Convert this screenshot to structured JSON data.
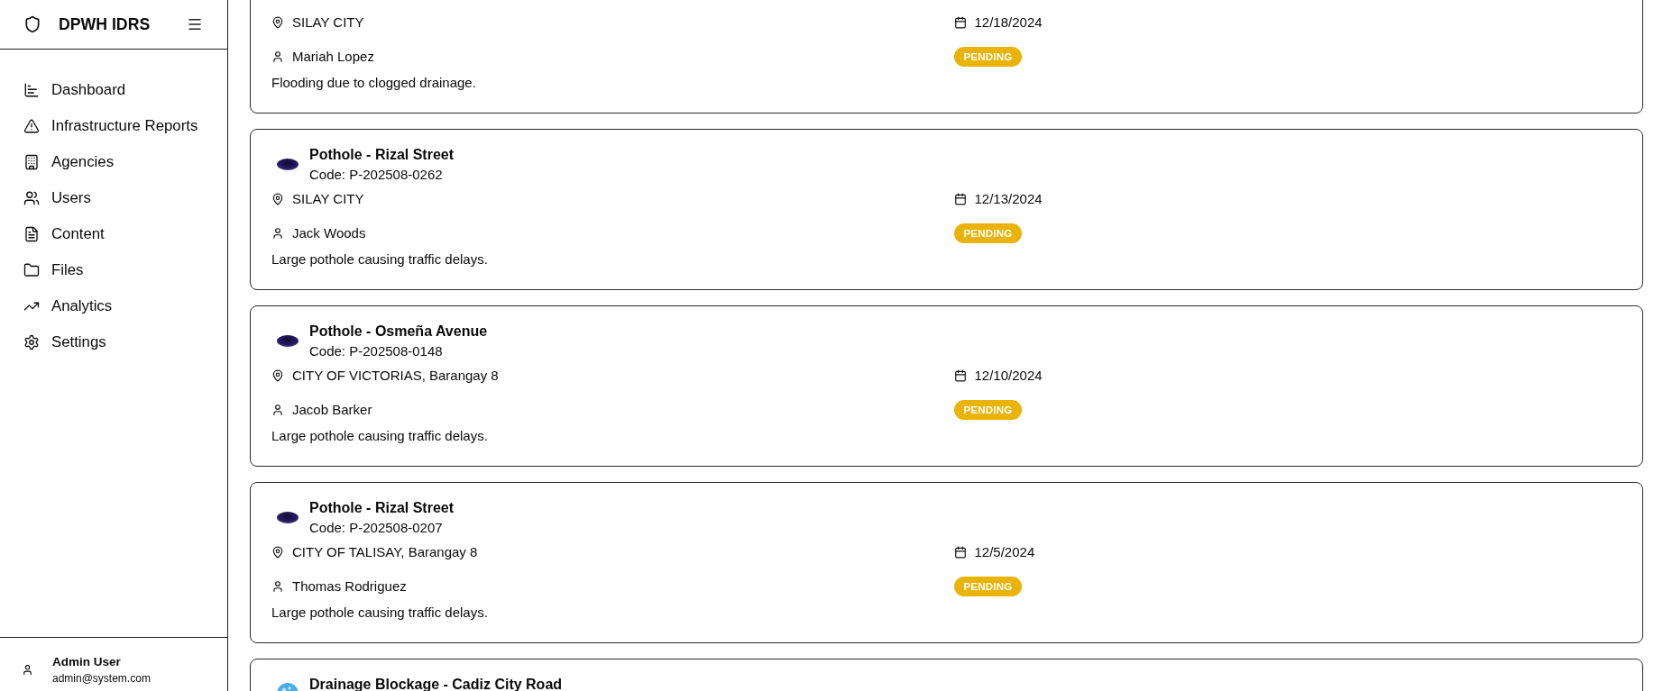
{
  "sidebar": {
    "brand": "DPWH IDRS",
    "items": [
      {
        "label": "Dashboard"
      },
      {
        "label": "Infrastructure Reports"
      },
      {
        "label": "Agencies"
      },
      {
        "label": "Users"
      },
      {
        "label": "Content"
      },
      {
        "label": "Files"
      },
      {
        "label": "Analytics"
      },
      {
        "label": "Settings"
      }
    ],
    "user": {
      "name": "Admin User",
      "email": "admin@system.com"
    }
  },
  "reports": [
    {
      "location": "SILAY CITY",
      "date": "12/18/2024",
      "reporter": "Mariah Lopez",
      "status": "PENDING",
      "description": "Flooding due to clogged drainage."
    },
    {
      "kind": "pothole",
      "title": "Pothole - Rizal Street",
      "code": "Code: P-202508-0262",
      "location": "SILAY CITY",
      "date": "12/13/2024",
      "reporter": "Jack Woods",
      "status": "PENDING",
      "description": "Large pothole causing traffic delays."
    },
    {
      "kind": "pothole",
      "title": "Pothole - Osmeña Avenue",
      "code": "Code: P-202508-0148",
      "location": "CITY OF VICTORIAS, Barangay 8",
      "date": "12/10/2024",
      "reporter": "Jacob Barker",
      "status": "PENDING",
      "description": "Large pothole causing traffic delays."
    },
    {
      "kind": "pothole",
      "title": "Pothole - Rizal Street",
      "code": "Code: P-202508-0207",
      "location": "CITY OF TALISAY, Barangay 8",
      "date": "12/5/2024",
      "reporter": "Thomas Rodriguez",
      "status": "PENDING",
      "description": "Large pothole causing traffic delays."
    },
    {
      "kind": "drainage",
      "title": "Drainage Blockage - Cadiz City Road"
    }
  ]
}
